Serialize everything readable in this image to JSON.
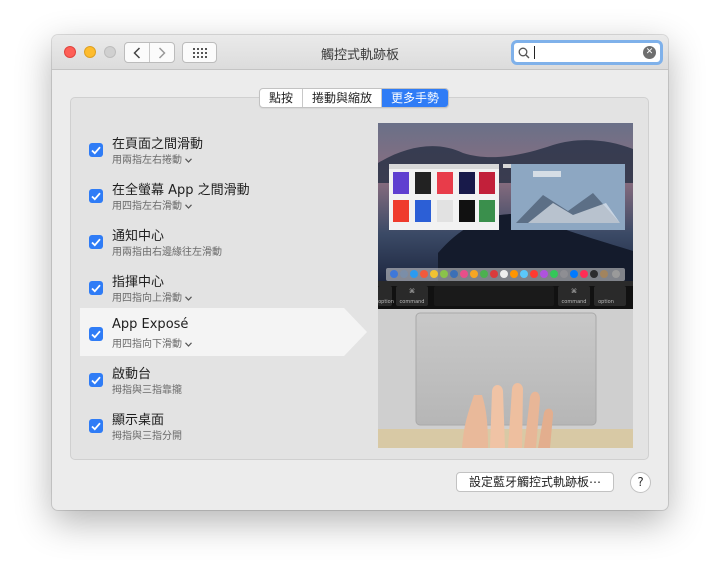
{
  "window": {
    "title": "觸控式軌跡板",
    "search": {
      "value": "",
      "placeholder": ""
    }
  },
  "tabs": [
    {
      "label": "點按",
      "active": false
    },
    {
      "label": "捲動與縮放",
      "active": false
    },
    {
      "label": "更多手勢",
      "active": true
    }
  ],
  "gestures": [
    {
      "title": "在頁面之間滑動",
      "subtitle": "用兩指左右捲動",
      "has_menu": true,
      "checked": true
    },
    {
      "title": "在全螢幕 App 之間滑動",
      "subtitle": "用四指左右滑動",
      "has_menu": true,
      "checked": true
    },
    {
      "title": "通知中心",
      "subtitle": "用兩指由右邊緣往左滑動",
      "has_menu": false,
      "checked": true
    },
    {
      "title": "指揮中心",
      "subtitle": "用四指向上滑動",
      "has_menu": true,
      "checked": true
    },
    {
      "title": "App Exposé",
      "subtitle": "用四指向下滑動",
      "has_menu": true,
      "checked": true,
      "selected": true
    },
    {
      "title": "啟動台",
      "subtitle": "拇指與三指靠攏",
      "has_menu": false,
      "checked": true
    },
    {
      "title": "顯示桌面",
      "subtitle": "拇指與三指分開",
      "has_menu": false,
      "checked": true
    }
  ],
  "preview": {
    "touchbar_keys": [
      "option",
      "command",
      "command",
      "option"
    ],
    "touchbar_symbol": "⌘"
  },
  "bluetooth_button": "設定藍牙觸控式軌跡板⋯",
  "help_label": "?",
  "colors": {
    "accent": "#2f7cf6",
    "close": "#fe5f57",
    "minimize": "#febc2e"
  }
}
